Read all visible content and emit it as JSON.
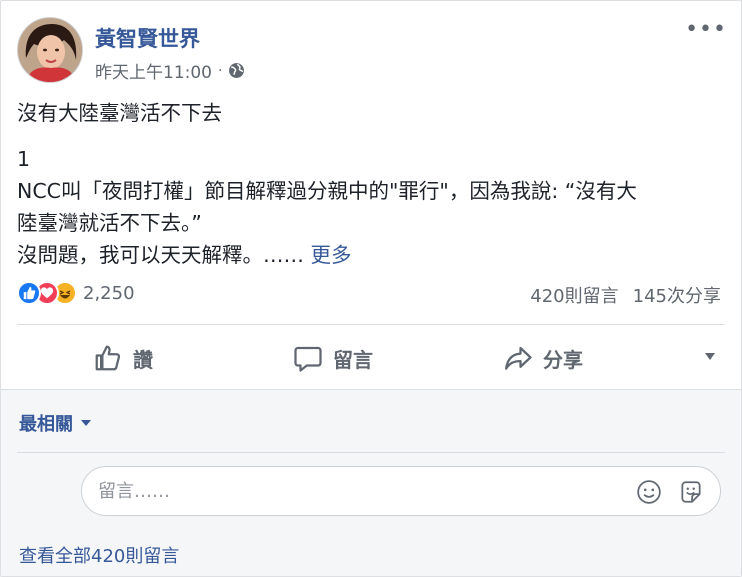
{
  "post": {
    "author": "黃智賢世界",
    "timestamp": "昨天上午11:00",
    "separator": "·",
    "privacy_icon": "globe-icon",
    "more_options_label": "•••",
    "text_lines": [
      "沒有大陸臺灣活不下去",
      "1",
      "NCC叫「夜問打權」節目解釋過分親中的\"罪行\"，因為我說: “沒有大",
      "陸臺灣就活不下去。”",
      "沒問題，我可以天天解釋。……"
    ],
    "see_more": "更多"
  },
  "reactions": {
    "icons": [
      "like-icon",
      "love-icon",
      "haha-icon"
    ],
    "count": "2,250",
    "comments_count": "420則留言",
    "shares_count": "145次分享"
  },
  "actions": {
    "like": "讚",
    "comment": "留言",
    "share": "分享"
  },
  "comments": {
    "sort_label": "最相關",
    "input_placeholder": "留言……",
    "view_all": "查看全部420則留言"
  },
  "colors": {
    "link": "#365899",
    "secondary_text": "#606770",
    "like_blue": "#1877f2",
    "love_red": "#f33e58",
    "haha_yellow": "#f7b125"
  }
}
